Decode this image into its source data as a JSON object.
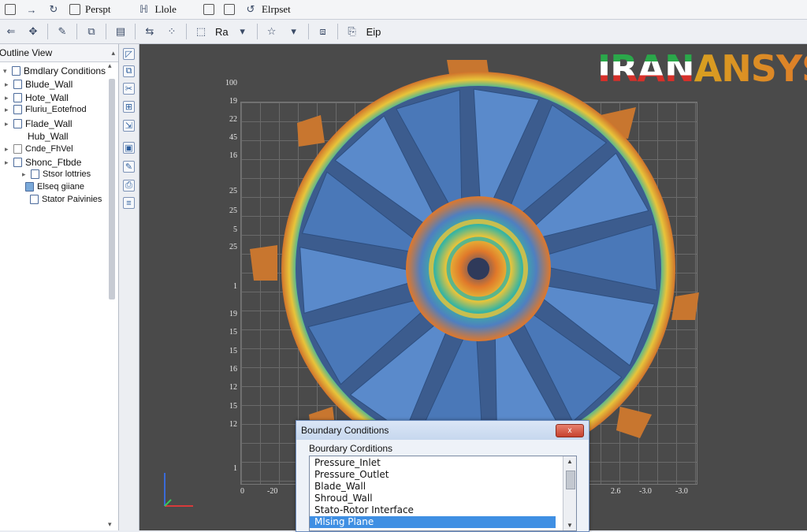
{
  "menubar": {
    "items": [
      "Perspt",
      "Llole",
      "Elrpset"
    ]
  },
  "toolbar": {
    "ra_label": "Ra",
    "eip_label": "Eip"
  },
  "outline": {
    "title": "Outline View",
    "items": [
      {
        "label": "Bmdlary Conditions"
      },
      {
        "label": "Blude_Wall"
      },
      {
        "label": "Hote_Wall"
      },
      {
        "label": "Fluriu_Eotefnod"
      },
      {
        "label": "Flade_Wall"
      },
      {
        "label": "Hub_Wall"
      },
      {
        "label": "Cnde_FhVel"
      },
      {
        "label": "Shonc_Ftbde"
      },
      {
        "label": "Stsor lottries"
      },
      {
        "label": "Elseq giiane"
      },
      {
        "label": "Stator Paivinies"
      }
    ]
  },
  "viewport": {
    "y_labels": [
      "100",
      "19",
      "22",
      "45",
      "16",
      "25",
      "25",
      "5",
      "25",
      "1",
      "19",
      "15",
      "15",
      "16",
      "12",
      "15",
      "12",
      "1"
    ],
    "x_labels": [
      "0",
      "-20",
      "2.6",
      "-3.0",
      "-3.0"
    ],
    "logo_left": "IRAN",
    "logo_right": "ANSYS",
    "colors": {
      "background": "#4a4a4a",
      "blade": "#4f7fc0",
      "hot": "#e0782a",
      "mid": "#39b5a0"
    }
  },
  "dialog": {
    "title": "Boundary Conditions",
    "close": "x",
    "label": "Bourdary Corditions",
    "items": [
      "Pressure_Inlet",
      "Pressure_Outlet",
      "Blade_Wall",
      "Shroud_Wall",
      "Stato-Rotor Interface",
      "Mlsing Plane"
    ],
    "selected_index": 5
  }
}
